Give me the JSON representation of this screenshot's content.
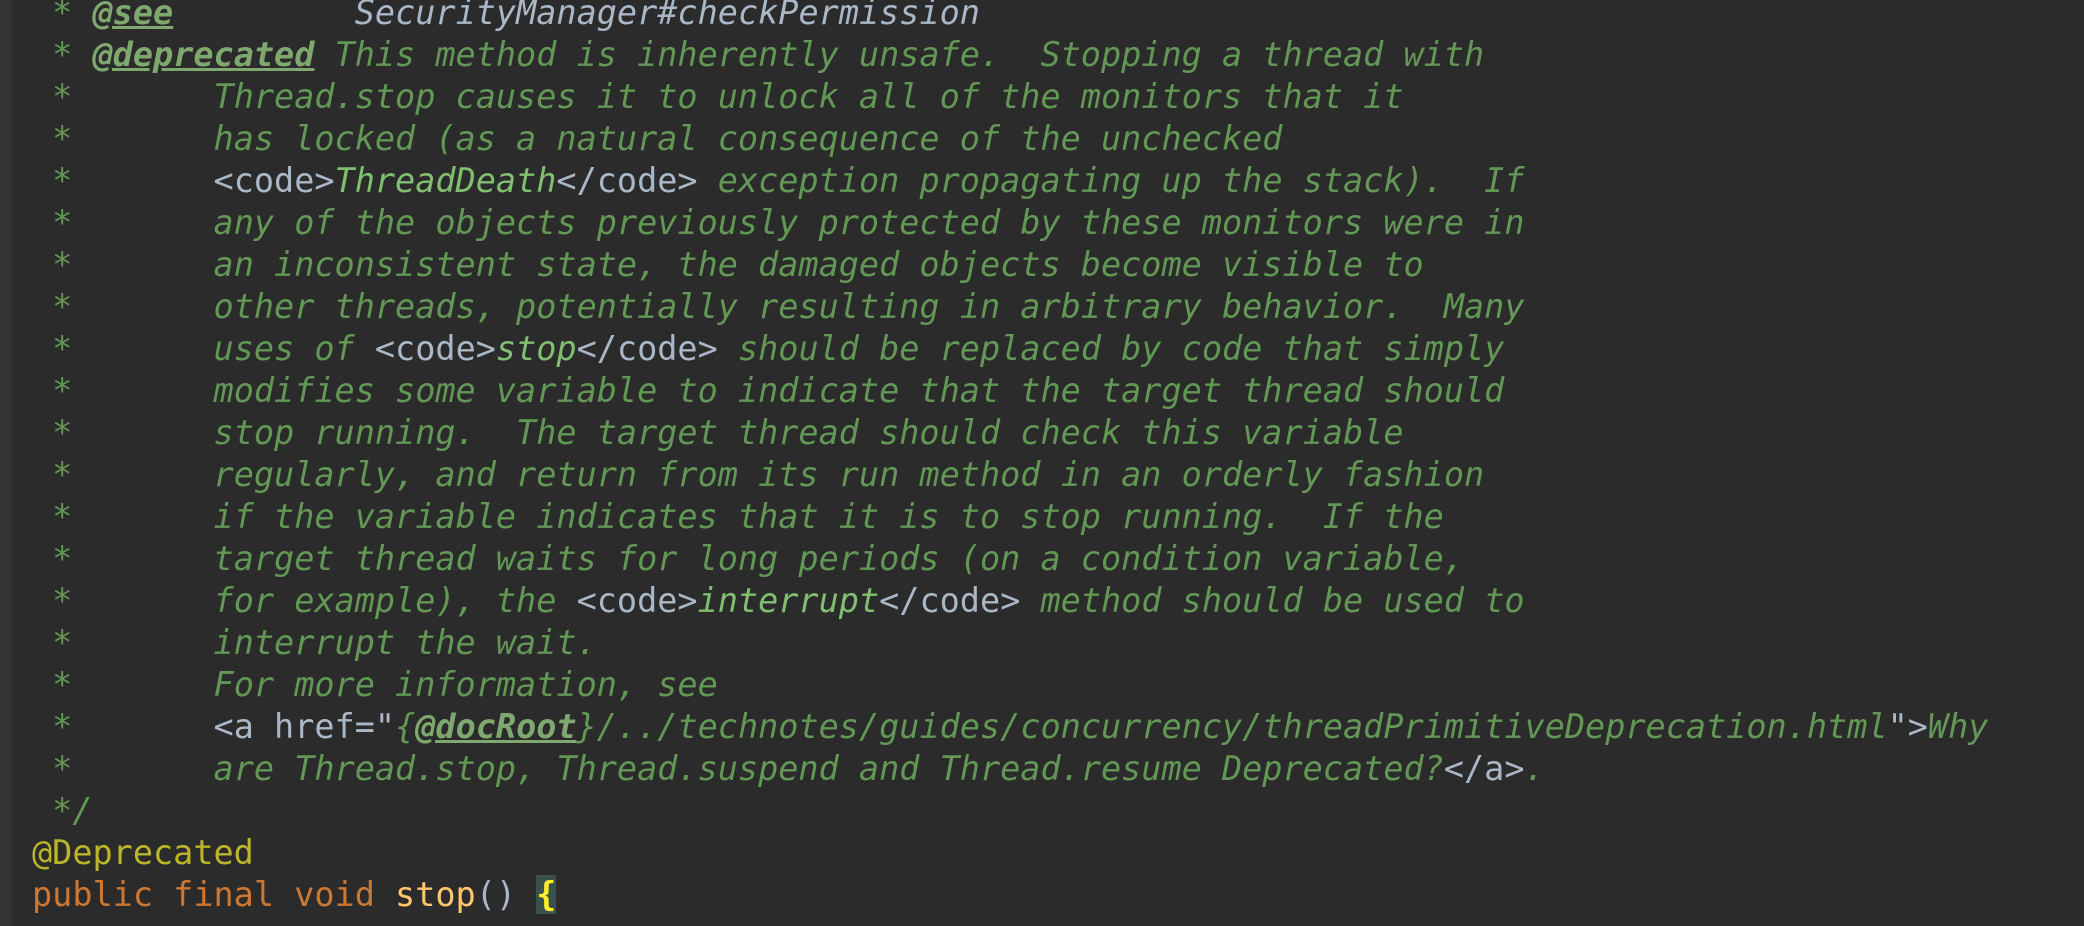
{
  "lines": {
    "l0": {
      "star": " * ",
      "tag": "@see",
      "gap": "         ",
      "ref": "SecurityManager#checkPermission"
    },
    "l1": {
      "star": " * ",
      "tag": "@deprecated",
      "text": " This method is inherently unsafe.  Stopping a thread with"
    },
    "l2": {
      "prefix": " *       ",
      "text": "Thread.stop causes it to unlock all of the monitors that it"
    },
    "l3": {
      "prefix": " *       ",
      "text": "has locked (as a natural consequence of the unchecked"
    },
    "l4": {
      "prefix": " *       ",
      "open": "<code>",
      "code": "ThreadDeath",
      "close": "</code>",
      "text": " exception propagating up the stack).  If"
    },
    "l5": {
      "prefix": " *       ",
      "text": "any of the objects previously protected by these monitors were in"
    },
    "l6": {
      "prefix": " *       ",
      "text": "an inconsistent state, the damaged objects become visible to"
    },
    "l7": {
      "prefix": " *       ",
      "text": "other threads, potentially resulting in arbitrary behavior.  Many"
    },
    "l8": {
      "prefix": " *       ",
      "pre": "uses of ",
      "open": "<code>",
      "code": "stop",
      "close": "</code>",
      "text": " should be replaced by code that simply"
    },
    "l9": {
      "prefix": " *       ",
      "text": "modifies some variable to indicate that the target thread should"
    },
    "l10": {
      "prefix": " *       ",
      "text": "stop running.  The target thread should check this variable"
    },
    "l11": {
      "prefix": " *       ",
      "text": "regularly, and return from its run method in an orderly fashion"
    },
    "l12": {
      "prefix": " *       ",
      "text": "if the variable indicates that it is to stop running.  If the"
    },
    "l13": {
      "prefix": " *       ",
      "text": "target thread waits for long periods (on a condition variable,"
    },
    "l14": {
      "prefix": " *       ",
      "pre": "for example), the ",
      "open": "<code>",
      "code": "interrupt",
      "close": "</code>",
      "text": " method should be used to"
    },
    "l15": {
      "prefix": " *       ",
      "text": "interrupt the wait."
    },
    "l16": {
      "prefix": " *       ",
      "text": "For more information, see"
    },
    "l17": {
      "prefix": " *       ",
      "open": "<a href=\"",
      "b1": "{",
      "docroot": "@docRoot",
      "b2": "}",
      "path": "/../technotes/guides/concurrency/threadPrimitiveDeprecation.html",
      "close": "\">",
      "text": "Why"
    },
    "l18": {
      "prefix": " *       ",
      "text": "are Thread.stop, Thread.suspend and Thread.resume Deprecated?",
      "close": "</a>",
      "end": "."
    },
    "l19": {
      "text": " */"
    },
    "l20": {
      "ann": "@Deprecated"
    },
    "l21": {
      "kw": "public final void ",
      "fn": "stop",
      "paren": "() ",
      "brace": "{"
    }
  }
}
